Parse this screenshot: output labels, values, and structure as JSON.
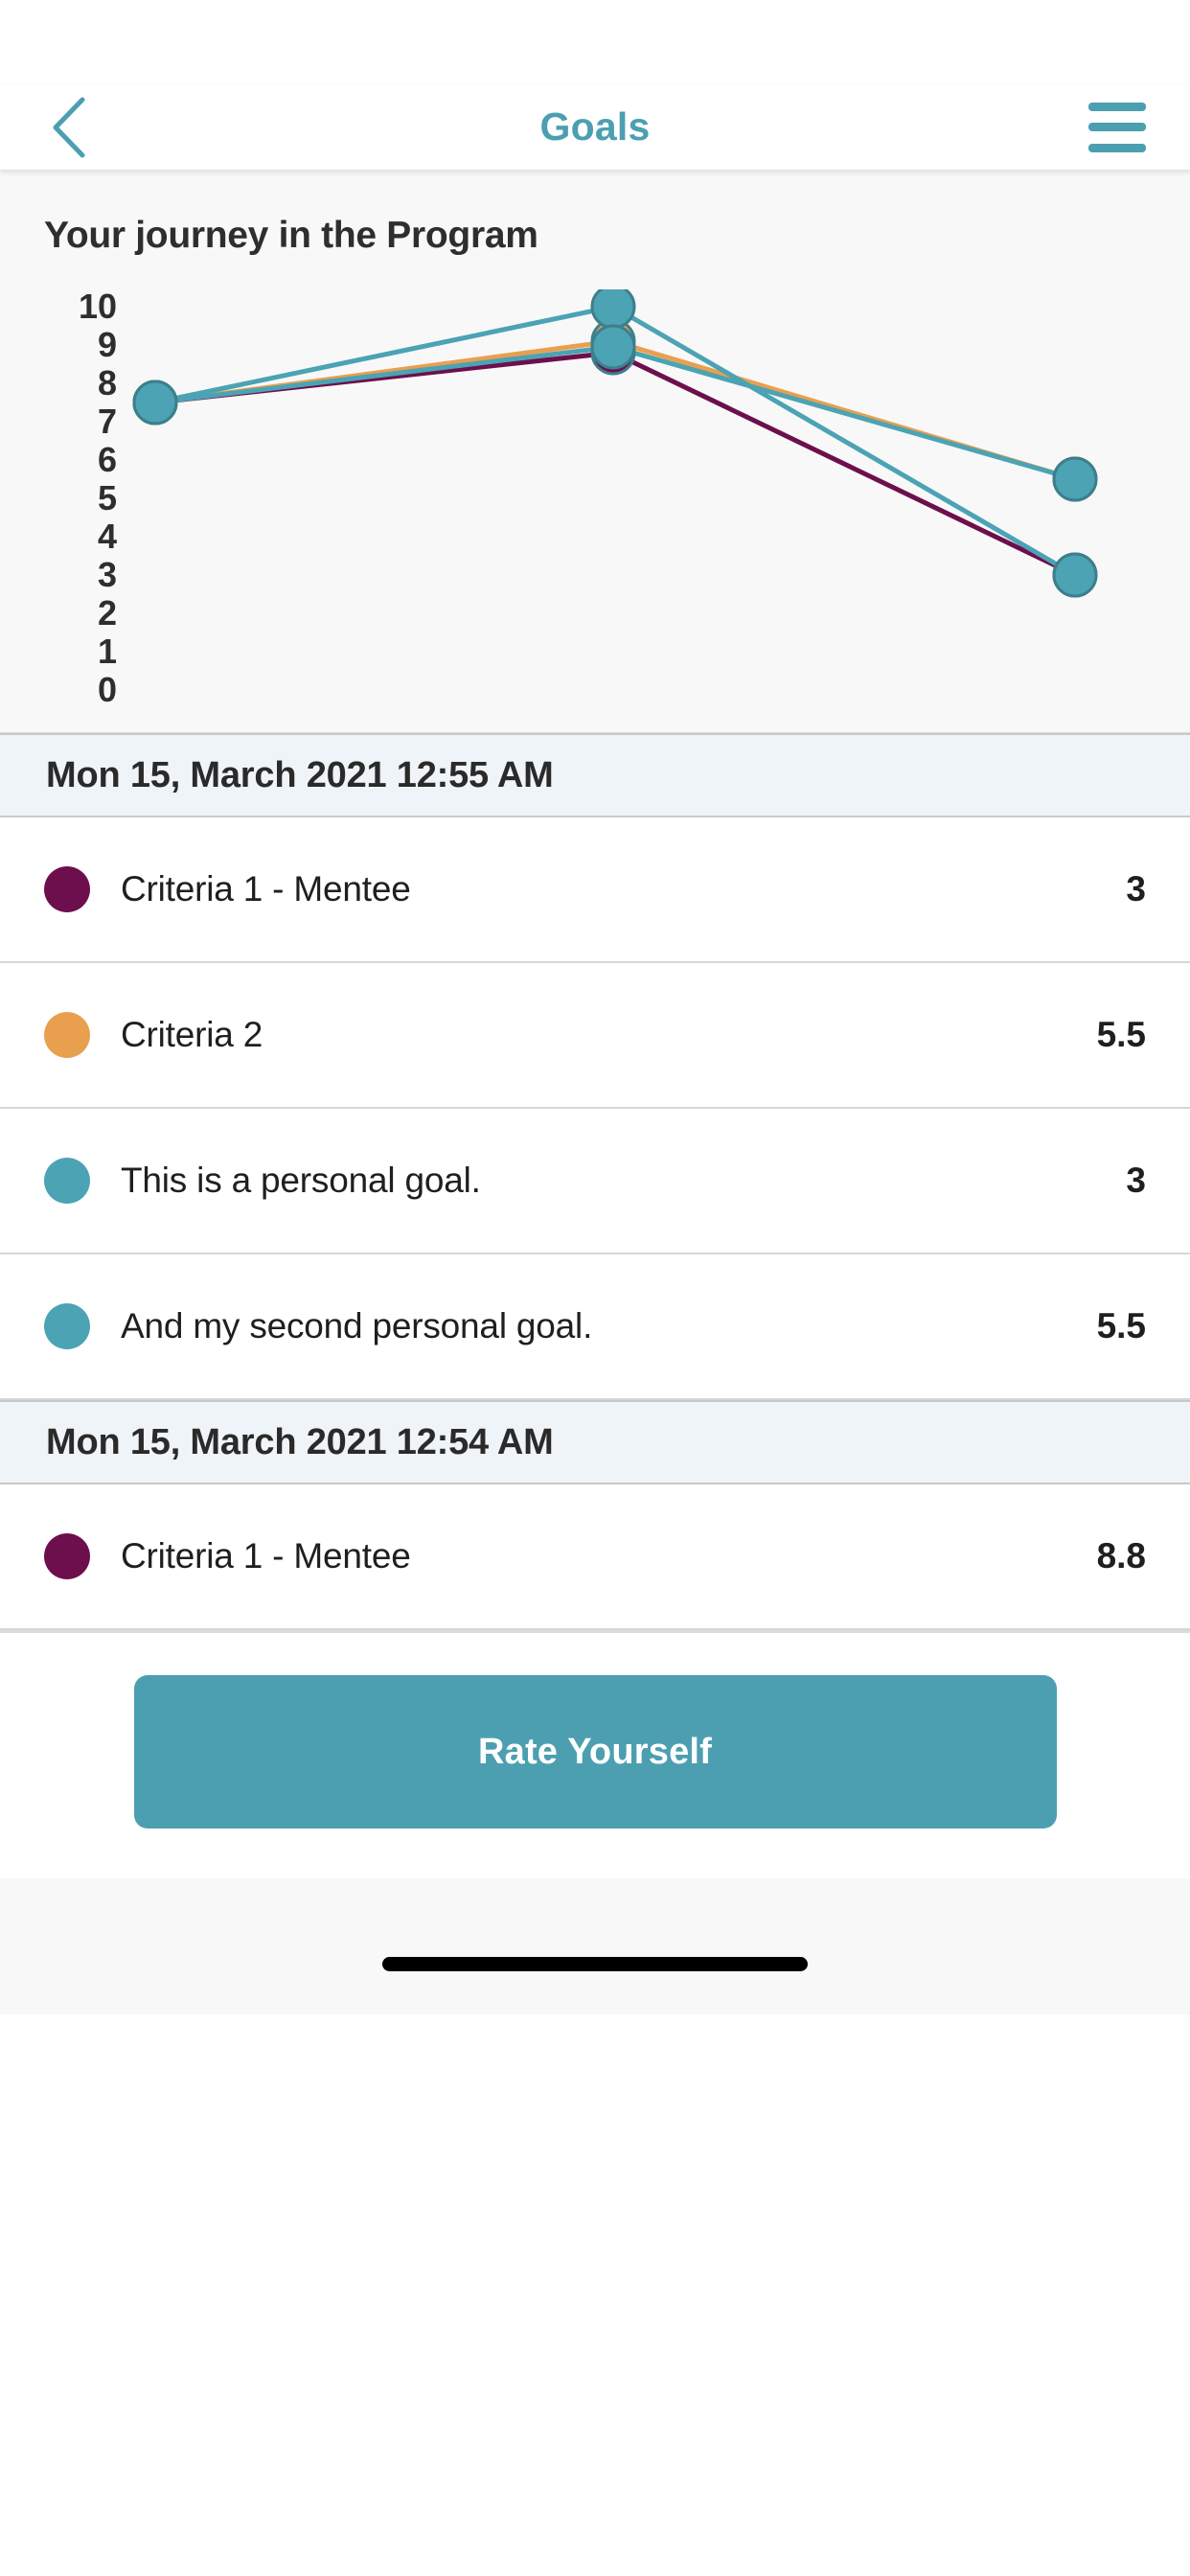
{
  "header": {
    "title": "Goals",
    "back_icon": "chevron-left-icon",
    "menu_icon": "hamburger-menu-icon",
    "accent_color": "#4c9fb0"
  },
  "chart_card": {
    "title": "Your journey in the Program"
  },
  "chart_data": {
    "type": "line",
    "title": "Your journey in the Program",
    "xlabel": "",
    "ylabel": "",
    "ylim": [
      0,
      10
    ],
    "ytick_labels": [
      "10",
      "9",
      "8",
      "7",
      "6",
      "5",
      "4",
      "3",
      "2",
      "1",
      "0"
    ],
    "grid": false,
    "legend": "none",
    "x": [
      1,
      2,
      3
    ],
    "series": [
      {
        "name": "Criteria 1 - Mentee",
        "color": "#6d0f4d",
        "values": [
          7.5,
          8.8,
          3
        ]
      },
      {
        "name": "Criteria 2",
        "color": "#e8a04f",
        "values": [
          7.5,
          9.1,
          5.5
        ]
      },
      {
        "name": "This is a personal goal.",
        "color": "#4ba3b4",
        "values": [
          7.5,
          10,
          3
        ]
      },
      {
        "name": "And my second personal goal.",
        "color": "#4ba3b4",
        "values": [
          7.5,
          8.95,
          5.5
        ]
      }
    ]
  },
  "list": {
    "groups": [
      {
        "date": "Mon 15, March 2021 12:55 AM",
        "rows": [
          {
            "color": "#6d0f4d",
            "label": "Criteria 1 - Mentee",
            "value": "3"
          },
          {
            "color": "#e8a04f",
            "label": "Criteria 2",
            "value": "5.5"
          },
          {
            "color": "#4ba3b4",
            "label": "This is a personal goal.",
            "value": "3"
          },
          {
            "color": "#4ba3b4",
            "label": "And my second personal goal.",
            "value": "5.5"
          }
        ]
      },
      {
        "date": "Mon 15, March 2021 12:54 AM",
        "rows": [
          {
            "color": "#6d0f4d",
            "label": "Criteria 1 - Mentee",
            "value": "8.8"
          }
        ]
      }
    ]
  },
  "footer": {
    "cta_label": "Rate Yourself",
    "cta_color": "#4c9fb0"
  }
}
